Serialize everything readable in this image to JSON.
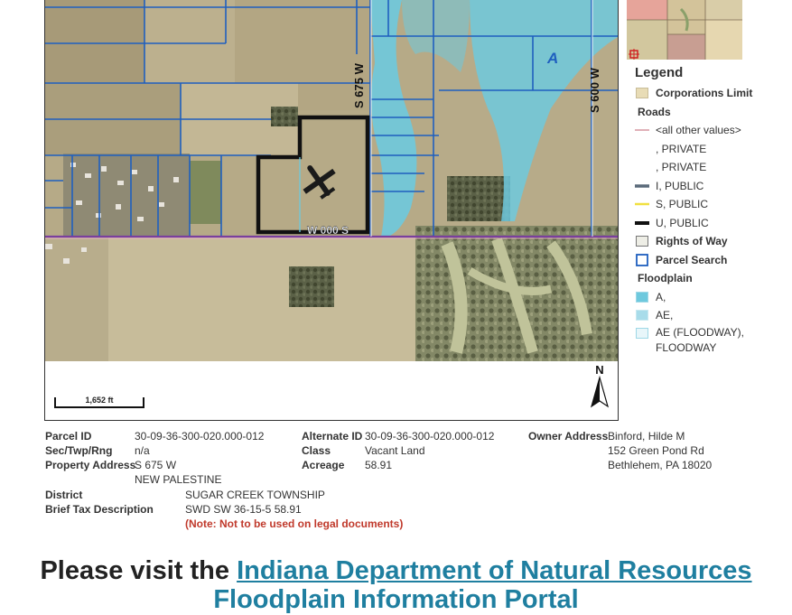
{
  "map": {
    "road_labels": {
      "s675w": "S 675 W",
      "s600w": "S 600 W",
      "w000s": "W 000 S"
    },
    "zone_label": "A",
    "scale_label": "1,652 ft",
    "north_label": "N",
    "colors": {
      "parcel_line": "#1f5fbf",
      "floodplain": "#6ec9de",
      "road_u": "#111111",
      "county_line": "#7a3f9e"
    }
  },
  "legend": {
    "title": "Legend",
    "items": [
      {
        "label": "Corporations Limit",
        "bold": true
      },
      {
        "label": "Roads",
        "bold": true
      },
      {
        "label": "<all other values>",
        "bold": false
      },
      {
        "label": ", PRIVATE",
        "bold": false
      },
      {
        "label": ", PRIVATE",
        "bold": false
      },
      {
        "label": "I, PUBLIC",
        "bold": false
      },
      {
        "label": "S, PUBLIC",
        "bold": false
      },
      {
        "label": "U, PUBLIC",
        "bold": false
      },
      {
        "label": "Rights of Way",
        "bold": true
      },
      {
        "label": "Parcel Search",
        "bold": true
      },
      {
        "label": "Floodplain",
        "bold": true
      },
      {
        "label": "A,",
        "bold": false
      },
      {
        "label": "AE,",
        "bold": false
      },
      {
        "label": "AE (FLOODWAY),",
        "bold": false
      },
      {
        "label": "FLOODWAY",
        "bold": false
      }
    ]
  },
  "parcel": {
    "parcel_id_label": "Parcel ID",
    "parcel_id": "30-09-36-300-020.000-012",
    "sec_label": "Sec/Twp/Rng",
    "sec": "n/a",
    "address_label": "Property Address",
    "address_line1": "S 675 W",
    "address_line2": "NEW PALESTINE",
    "district_label": "District",
    "district": "SUGAR CREEK TOWNSHIP",
    "tax_label": "Brief Tax Description",
    "tax": "SWD SW 36-15-5 58.91",
    "note": "(Note: Not to be used on legal documents)",
    "alt_id_label": "Alternate ID",
    "alt_id": "30-09-36-300-020.000-012",
    "class_label": "Class",
    "class": "Vacant Land",
    "acreage_label": "Acreage",
    "acreage": "58.91",
    "owner_label": "Owner Address",
    "owner_name": "Binford, Hilde M",
    "owner_street": "152 Green Pond Rd",
    "owner_city": "Bethlehem, PA 18020"
  },
  "banner": {
    "prefix": "Please visit the ",
    "link": "Indiana Department of Natural Resources",
    "line2": "Floodplain Information Portal"
  }
}
